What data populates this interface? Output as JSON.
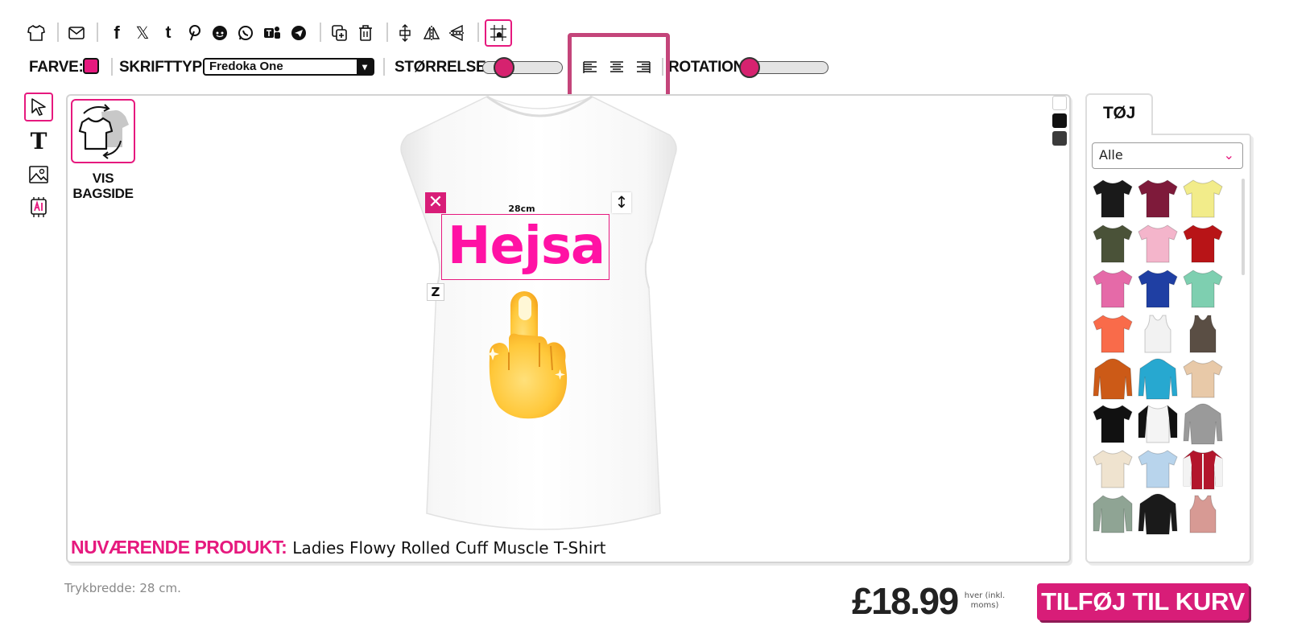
{
  "toolbar_icons": [
    "tshirt-icon",
    "mail-icon",
    "facebook-icon",
    "x-icon",
    "tumblr-icon",
    "pinterest-icon",
    "reddit-icon",
    "whatsapp-icon",
    "teams-icon",
    "telegram-icon",
    "duplicate-icon",
    "trash-icon",
    "align-vertical-icon",
    "flip-horizontal-icon",
    "flip-vertical-icon",
    "grid-snap-icon"
  ],
  "props": {
    "color_label": "FARVE:",
    "color_value": "#e6197e",
    "font_label": "SKRIFTTYPE:",
    "font_value": "Fredoka One",
    "size_label": "STØRRELSE:",
    "size_level": 0.2,
    "rotation_label": "ROTATION:",
    "rotation_level": 0.0
  },
  "tools": [
    "pointer-icon",
    "text-tool-icon",
    "image-tool-icon",
    "ai-tool-icon"
  ],
  "canvas": {
    "show_back_label_1": "VIS",
    "show_back_label_2": "BAGSIDE",
    "design_text": "Hejsa",
    "dimension_label": "28cm",
    "current_product_key": "NUVÆRENDE PRODUKT:",
    "current_product_value": "Ladies Flowy Rolled Cuff Muscle T-Shirt",
    "background_swatches": [
      "#ffffff",
      "#111111",
      "#3a3a3a"
    ]
  },
  "panel": {
    "tab_label": "TØJ",
    "filter_value": "Alle",
    "products": [
      {
        "kind": "tee",
        "color": "#1a1a1a"
      },
      {
        "kind": "tee",
        "color": "#7e1a3a"
      },
      {
        "kind": "tee",
        "color": "#f2ec8a"
      },
      {
        "kind": "tee",
        "color": "#4a5238"
      },
      {
        "kind": "tee",
        "color": "#f4b5cb"
      },
      {
        "kind": "tee",
        "color": "#b81417"
      },
      {
        "kind": "tee",
        "color": "#e56aa8"
      },
      {
        "kind": "tee",
        "color": "#1f3fa3"
      },
      {
        "kind": "tee",
        "color": "#7ecfb0"
      },
      {
        "kind": "tee",
        "color": "#f96b4a"
      },
      {
        "kind": "tank",
        "color": "#f2f2f2"
      },
      {
        "kind": "tank",
        "color": "#5a4e44"
      },
      {
        "kind": "hoodie",
        "color": "#cc5a17"
      },
      {
        "kind": "hoodie",
        "color": "#27a8d0"
      },
      {
        "kind": "tee",
        "color": "#e8c9a8"
      },
      {
        "kind": "tee",
        "color": "#111111"
      },
      {
        "kind": "raglan",
        "color": "#f4f4f4"
      },
      {
        "kind": "hoodie",
        "color": "#9a9a9a"
      },
      {
        "kind": "tee",
        "color": "#efe3cf"
      },
      {
        "kind": "tee",
        "color": "#b8d4ec"
      },
      {
        "kind": "jacket",
        "color": "#b3162c"
      },
      {
        "kind": "longsleeve",
        "color": "#8fa494"
      },
      {
        "kind": "hoodie",
        "color": "#1a1a1a"
      },
      {
        "kind": "tank",
        "color": "#d79a94"
      }
    ]
  },
  "footer": {
    "print_width": "Trykbredde: 28 cm.",
    "price": "£18.99",
    "price_note_1": "hver (inkl.",
    "price_note_2": "moms)",
    "cart_button": "TILFØJ TIL KURV"
  }
}
